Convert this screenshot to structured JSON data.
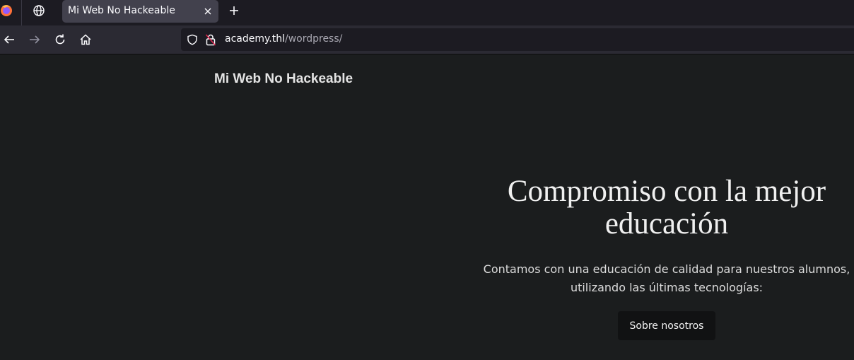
{
  "browser": {
    "tab": {
      "title": "Mi Web No Hackeable"
    },
    "url": {
      "host": "academy.thl",
      "path": "/wordpress/"
    }
  },
  "site": {
    "title": "Mi Web No Hackeable"
  },
  "hero": {
    "heading": "Compromiso con la mejor educación",
    "text": "Contamos con una educación de calidad para nuestros alumnos, utilizando las últimas tecnologías:",
    "button_label": "Sobre nosotros"
  },
  "colors": {
    "page_background": "#1b1d1e",
    "button_background": "#111213",
    "browser_chrome": "#2b2a33",
    "active_tab": "#42414d"
  },
  "icons": [
    "firefox-logo-icon",
    "globe-icon",
    "close-icon",
    "plus-icon",
    "back-arrow-icon",
    "forward-arrow-icon",
    "reload-icon",
    "home-icon",
    "shield-icon",
    "insecure-lock-icon"
  ]
}
